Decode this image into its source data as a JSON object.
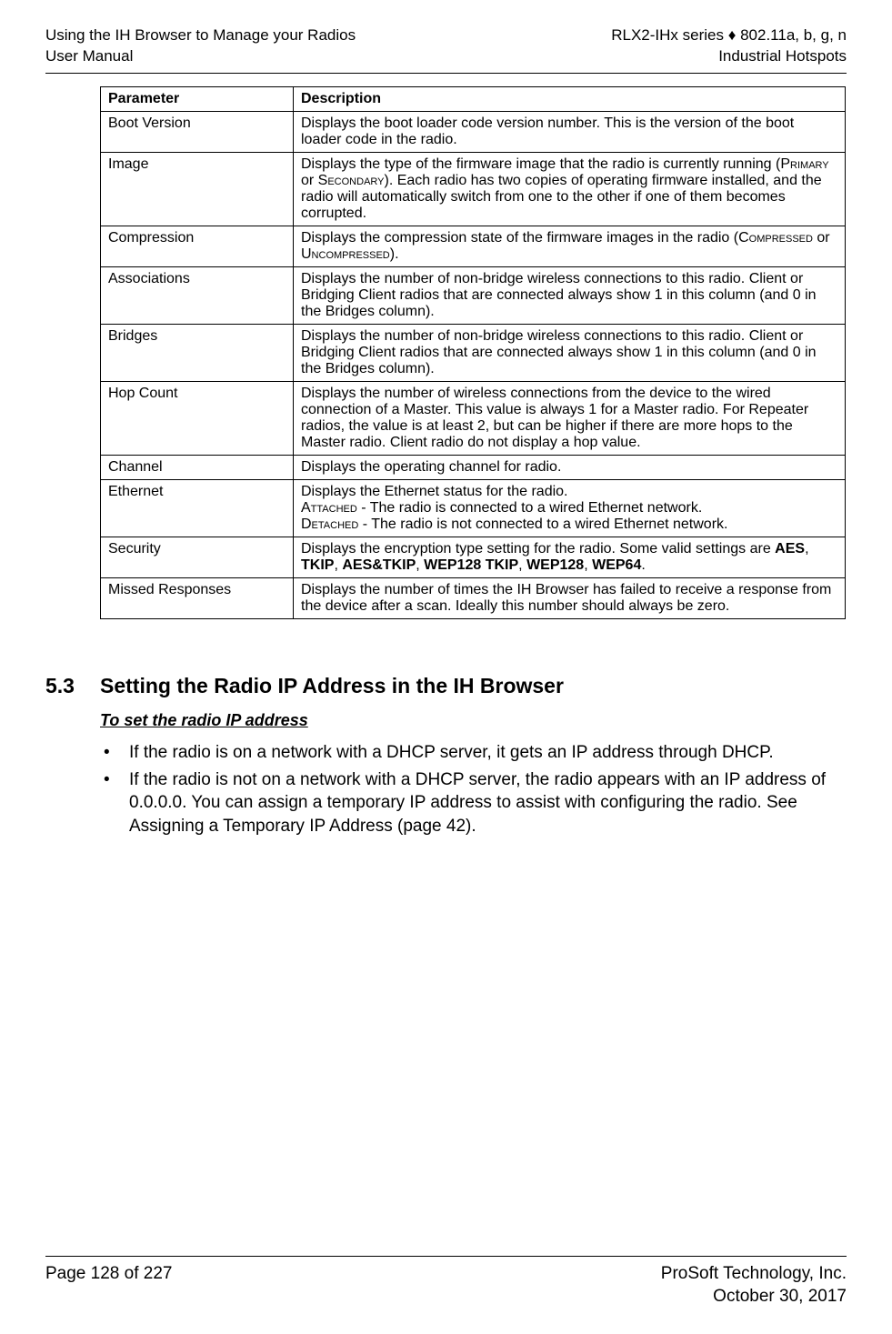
{
  "header": {
    "left_line1": "Using the IH Browser to Manage your Radios",
    "left_line2": "User Manual",
    "right_line1": "RLX2-IHx series ♦ 802.11a, b, g, n",
    "right_line2": "Industrial Hotspots"
  },
  "table": {
    "header_param": "Parameter",
    "header_desc": "Description",
    "rows": [
      {
        "param": "Boot Version",
        "desc_pre": "Displays the boot loader code version number. This is the version of the boot loader code in the radio."
      },
      {
        "param": "Image",
        "desc_pre": "Displays the type of the firmware image that the radio is currently running (",
        "sc1": "Primary",
        "mid1": " or ",
        "sc2": "Secondary",
        "desc_post": "). Each radio has two copies of operating firmware installed, and the radio will automatically switch from one to the other if one of them becomes corrupted."
      },
      {
        "param": "Compression",
        "desc_pre": "Displays the compression state of the firmware images in the radio (",
        "sc1": "Compressed",
        "mid1": " or ",
        "sc2": "Uncompressed",
        "desc_post": ")."
      },
      {
        "param": "Associations",
        "desc_pre": "Displays the number of non-bridge wireless connections to this radio. Client or Bridging Client radios that are connected always show 1 in this column (and 0 in the Bridges column)."
      },
      {
        "param": "Bridges",
        "desc_pre": "Displays the number of non-bridge wireless connections to this radio. Client or Bridging Client radios that are connected always show 1 in this column (and 0 in the Bridges column)."
      },
      {
        "param": "Hop Count",
        "desc_pre": "Displays the number of wireless connections from the device to the wired connection of a Master. This value is always 1 for a Master radio. For Repeater radios, the value is at least 2, but can be higher if there are more hops to the Master radio. Client radio do not display a hop value."
      },
      {
        "param": "Channel",
        "desc_pre": "Displays the operating channel for radio."
      },
      {
        "param": "Ethernet",
        "line1": "Displays the Ethernet status for the radio.",
        "sc1": "Attached",
        "line2_post": " - The radio is connected to a wired Ethernet network.",
        "sc2": "Detached",
        "line3_post": " - The radio is not connected to a wired Ethernet network."
      },
      {
        "param": "Security",
        "desc_pre": "Displays the encryption type setting for the radio. Some valid settings are ",
        "b1": "AES",
        "c1": ", ",
        "b2": "TKIP",
        "c2": ", ",
        "b3": "AES&TKIP",
        "c3": ", ",
        "b4": "WEP128 TKIP",
        "c4": ", ",
        "b5": "WEP128",
        "c5": ", ",
        "b6": "WEP64",
        "c6": "."
      },
      {
        "param": "Missed Responses",
        "desc_pre": "Displays the number of times the IH Browser has failed to receive a response from the device after a scan. Ideally this number should always be zero."
      }
    ]
  },
  "section": {
    "number": "5.3",
    "title": "Setting the Radio IP Address in the IH Browser",
    "subheading": "To set the radio IP address",
    "bullets": [
      "If the radio is on a network with a DHCP server, it gets an IP address through DHCP.",
      "If the radio is not on a network with a DHCP server, the radio appears with an IP address of 0.0.0.0. You can assign a temporary IP address to assist with configuring the radio. See Assigning a Temporary IP Address (page 42)."
    ]
  },
  "footer": {
    "left": "Page 128 of 227",
    "right_line1": "ProSoft Technology, Inc.",
    "right_line2": "October 30, 2017"
  }
}
